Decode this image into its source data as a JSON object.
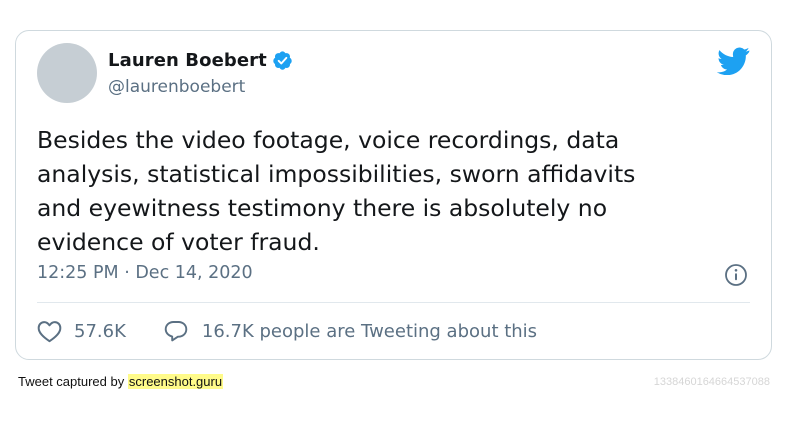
{
  "tweet": {
    "author": {
      "name": "Lauren Boebert",
      "handle": "@laurenboebert",
      "verified": true
    },
    "text_lines": [
      "Besides the video footage, voice recordings, data",
      "analysis, statistical impossibilities, sworn affidavits",
      "and eyewitness testimony there is absolutely no",
      "evidence of voter fraud."
    ],
    "timestamp": "12:25 PM · Dec 14, 2020",
    "likes": "57.6K",
    "tweeting_about": "16.7K people are Tweeting about this"
  },
  "icons": {
    "verified": "verified-badge-icon",
    "brand": "twitter-bird-icon",
    "info": "info-icon",
    "like": "heart-icon",
    "reply": "speech-bubble-icon"
  },
  "colors": {
    "twitter_blue": "#1da1f2",
    "text": "#14171a",
    "secondary": "#5b7083",
    "highlight": "#fffb8a"
  },
  "footer": {
    "captured_label": "Tweet captured by",
    "site": "screenshot.guru",
    "tweet_id": "1338460164664537088"
  }
}
